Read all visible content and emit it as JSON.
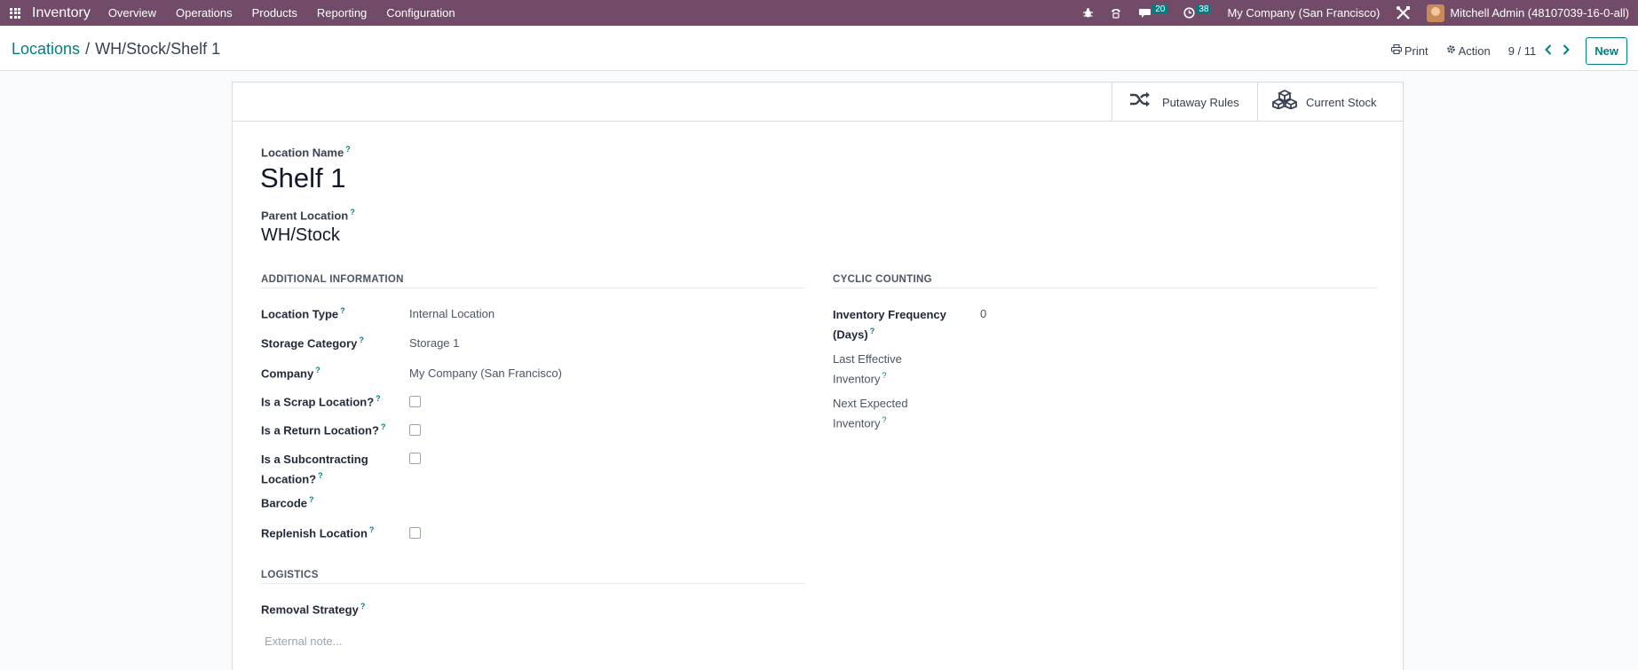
{
  "topbar": {
    "app_name": "Inventory",
    "menu": [
      "Overview",
      "Operations",
      "Products",
      "Reporting",
      "Configuration"
    ],
    "messages_count": "20",
    "activities_count": "38",
    "company": "My Company (San Francisco)",
    "user": "Mitchell Admin (48107039-16-0-all)"
  },
  "control": {
    "breadcrumb_parent": "Locations",
    "breadcrumb_separator": "/",
    "breadcrumb_current": "WH/Stock/Shelf 1",
    "print_label": "Print",
    "action_label": "Action",
    "pager": "9 / 11",
    "new_label": "New"
  },
  "smart_buttons": {
    "putaway": "Putaway Rules",
    "stock": "Current Stock"
  },
  "form": {
    "location_name_label": "Location Name",
    "location_name": "Shelf 1",
    "parent_location_label": "Parent Location",
    "parent_location": "WH/Stock",
    "additional_info_title": "ADDITIONAL INFORMATION",
    "cyclic_counting_title": "CYCLIC COUNTING",
    "logistics_title": "LOGISTICS",
    "location_type_label": "Location Type",
    "location_type": "Internal Location",
    "storage_category_label": "Storage Category",
    "storage_category": "Storage 1",
    "company_label": "Company",
    "company": "My Company (San Francisco)",
    "scrap_label": "Is a Scrap Location?",
    "return_label": "Is a Return Location?",
    "subcontracting_label_1": "Is a Subcontracting",
    "subcontracting_label_2": "Location?",
    "barcode_label": "Barcode",
    "replenish_label": "Replenish Location",
    "inventory_frequency_label_1": "Inventory Frequency",
    "inventory_frequency_label_2": "(Days)",
    "inventory_frequency": "0",
    "last_inventory_label_1": "Last Effective",
    "last_inventory_label_2": "Inventory",
    "next_inventory_label_1": "Next Expected",
    "next_inventory_label_2": "Inventory",
    "removal_strategy_label": "Removal Strategy",
    "external_note_placeholder": "External note..."
  },
  "tooltip_mark": "?",
  "colors": {
    "navbar": "#714b67",
    "accent": "#017e84"
  }
}
